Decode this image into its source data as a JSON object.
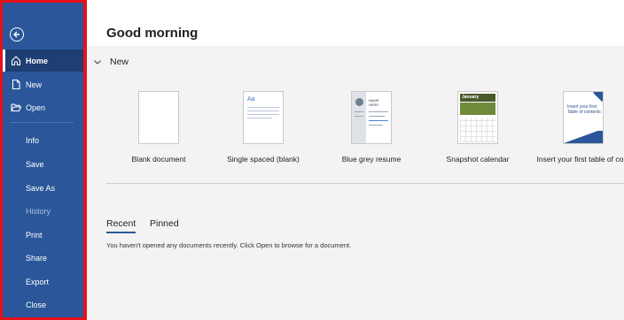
{
  "sidebar": {
    "items": [
      {
        "label": "Home",
        "icon": "home-icon",
        "state": "active"
      },
      {
        "label": "New",
        "icon": "new-document-icon",
        "state": "normal"
      },
      {
        "label": "Open",
        "icon": "folder-open-icon",
        "state": "normal"
      },
      {
        "label": "Info",
        "state": "normal"
      },
      {
        "label": "Save",
        "state": "normal"
      },
      {
        "label": "Save As",
        "state": "normal"
      },
      {
        "label": "History",
        "state": "disabled"
      },
      {
        "label": "Print",
        "state": "normal"
      },
      {
        "label": "Share",
        "state": "normal"
      },
      {
        "label": "Export",
        "state": "normal"
      },
      {
        "label": "Close",
        "state": "normal"
      }
    ],
    "colors": {
      "background": "#2b579a",
      "highlight_frame": "#e8101a"
    }
  },
  "main": {
    "greeting": "Good morning",
    "new_section": {
      "label": "New",
      "templates": [
        {
          "label": "Blank document"
        },
        {
          "label": "Single spaced (blank)",
          "thumb_text": "Aa"
        },
        {
          "label": "Blue grey resume",
          "thumb_text": "NAME HERE"
        },
        {
          "label": "Snapshot calendar",
          "thumb_text": "January"
        },
        {
          "label": "Insert your first table of cont",
          "thumb_text": "Insert your first Table of contents"
        }
      ]
    },
    "tabs": [
      {
        "label": "Recent",
        "active": true
      },
      {
        "label": "Pinned",
        "active": false
      }
    ],
    "empty_message": "You haven't opened any documents recently. Click Open to browse for a document."
  }
}
